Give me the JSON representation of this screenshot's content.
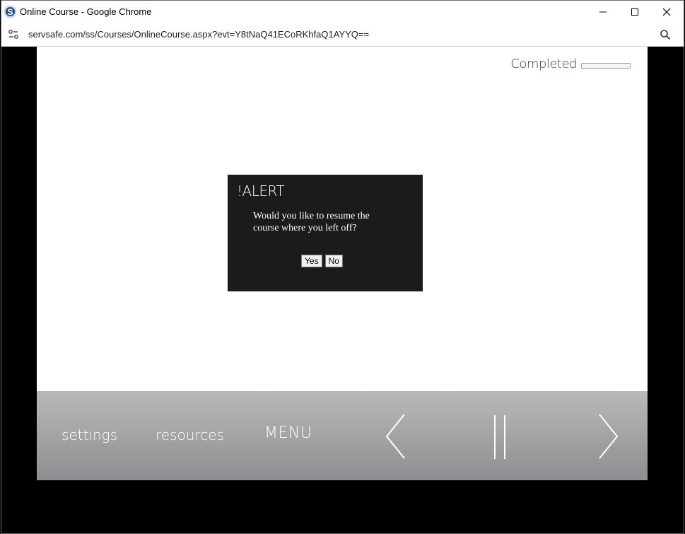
{
  "window": {
    "title": "Online Course - Google Chrome",
    "app_icon_letter": "S",
    "url": "servsafe.com/ss/Courses/OnlineCourse.aspx?evt=Y8tNaQ41ECoRKhfaQ1AYYQ==",
    "icons": [
      "minimize-icon",
      "maximize-icon",
      "close-icon",
      "site-info-icon",
      "zoom-icon"
    ]
  },
  "course": {
    "completed_label": "Completed",
    "progress_fraction": 0
  },
  "alert": {
    "title": "!ALERT",
    "message": "Would you like to resume the course where you left off?",
    "yes_label": "Yes",
    "no_label": "No"
  },
  "navbar": {
    "settings_label": "settings",
    "resources_label": "resources",
    "menu_label": "MENU",
    "icons": [
      "back-arrow-icon",
      "pause-icon",
      "next-arrow-icon"
    ]
  },
  "colors": {
    "alert_bg": "#1b1b1b",
    "navbar_top": "#b8b9bb",
    "navbar_bottom": "#8d8e90",
    "stage_bg": "#ffffff"
  }
}
